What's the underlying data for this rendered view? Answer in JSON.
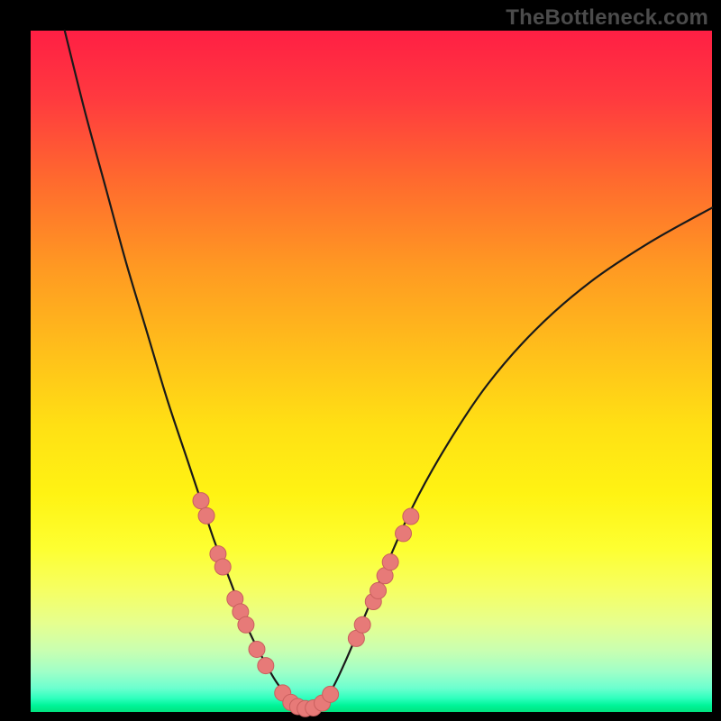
{
  "watermark": "TheBottleneck.com",
  "colors": {
    "curve_stroke": "#1a1a1a",
    "marker_fill": "#e77a78",
    "marker_stroke": "#c95f5e"
  },
  "chart_data": {
    "type": "line",
    "title": "TheBottleneck.com",
    "xlabel": "",
    "ylabel": "",
    "xlim": [
      0,
      1
    ],
    "ylim": [
      0,
      1
    ],
    "grid": false,
    "legend": false,
    "annotations": [],
    "series": [
      {
        "name": "bottleneck-curve",
        "x_note": "x in [0,1] normalized across plot width",
        "y_note": "y in [0,1] where 0 = bottom bright band, 1 = top; curve is |x - x_min| style V with curved arms, minimum near x≈0.40, arms rising toward top at x≈0.05 and beyond right edge",
        "x": [
          0.05,
          0.08,
          0.11,
          0.14,
          0.17,
          0.2,
          0.23,
          0.25,
          0.27,
          0.29,
          0.305,
          0.32,
          0.34,
          0.36,
          0.38,
          0.4,
          0.42,
          0.44,
          0.46,
          0.49,
          0.52,
          0.56,
          0.61,
          0.67,
          0.74,
          0.82,
          0.91,
          1.0
        ],
        "y": [
          1.0,
          0.88,
          0.77,
          0.66,
          0.56,
          0.46,
          0.37,
          0.31,
          0.25,
          0.2,
          0.16,
          0.12,
          0.08,
          0.045,
          0.02,
          0.005,
          0.01,
          0.03,
          0.07,
          0.14,
          0.21,
          0.3,
          0.39,
          0.48,
          0.56,
          0.63,
          0.69,
          0.74
        ]
      }
    ],
    "markers": {
      "name": "sample-points",
      "note": "discrete pink dots along the lower portion of both arms and across the trough",
      "points": [
        {
          "x": 0.25,
          "y": 0.31
        },
        {
          "x": 0.258,
          "y": 0.288
        },
        {
          "x": 0.275,
          "y": 0.232
        },
        {
          "x": 0.282,
          "y": 0.213
        },
        {
          "x": 0.3,
          "y": 0.166
        },
        {
          "x": 0.308,
          "y": 0.147
        },
        {
          "x": 0.316,
          "y": 0.128
        },
        {
          "x": 0.332,
          "y": 0.092
        },
        {
          "x": 0.345,
          "y": 0.068
        },
        {
          "x": 0.37,
          "y": 0.028
        },
        {
          "x": 0.382,
          "y": 0.014
        },
        {
          "x": 0.392,
          "y": 0.008
        },
        {
          "x": 0.403,
          "y": 0.005
        },
        {
          "x": 0.415,
          "y": 0.006
        },
        {
          "x": 0.428,
          "y": 0.013
        },
        {
          "x": 0.44,
          "y": 0.026
        },
        {
          "x": 0.478,
          "y": 0.108
        },
        {
          "x": 0.487,
          "y": 0.128
        },
        {
          "x": 0.503,
          "y": 0.162
        },
        {
          "x": 0.51,
          "y": 0.178
        },
        {
          "x": 0.52,
          "y": 0.2
        },
        {
          "x": 0.528,
          "y": 0.22
        },
        {
          "x": 0.547,
          "y": 0.262
        },
        {
          "x": 0.558,
          "y": 0.287
        }
      ]
    }
  }
}
